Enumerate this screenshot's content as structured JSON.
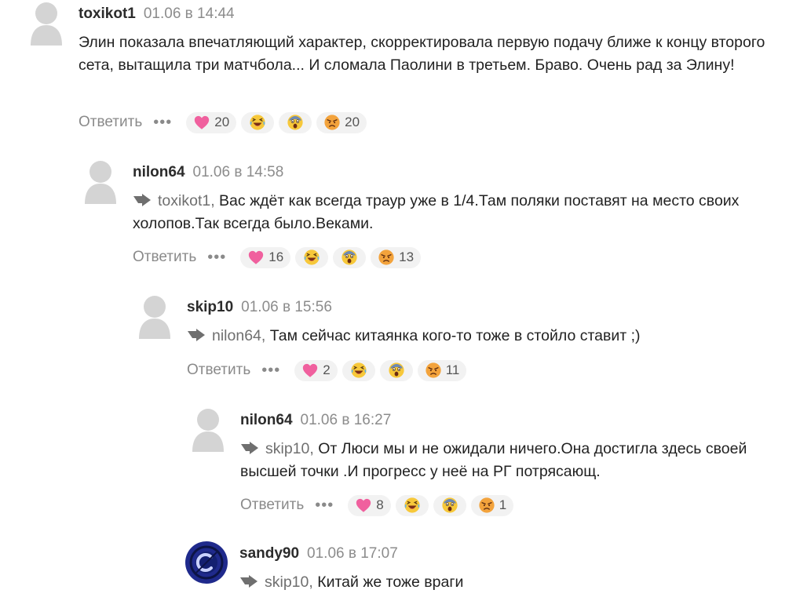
{
  "comments": [
    {
      "author": "toxikot1",
      "date": "01.06 в 14:44",
      "reply_to": "",
      "text": "Элин показала впечатляющий характер, скорректировала первую подачу ближе к концу второго сета, вытащила три матчбола... И сломала Паолини в третьем. Браво. Очень рад за Элину!",
      "reply_label": "Ответить",
      "more_label": "•••",
      "reactions": {
        "love": "20",
        "laugh": "",
        "shock": "",
        "angry": "20"
      }
    },
    {
      "author": "nilon64",
      "date": "01.06 в 14:58",
      "reply_to": "toxikot1,",
      "text": "Вас ждёт как всегда траур уже в 1/4.Там поляки поставят на место своих холопов.Так всегда было.Веками.",
      "reply_label": "Ответить",
      "more_label": "•••",
      "reactions": {
        "love": "16",
        "laugh": "",
        "shock": "",
        "angry": "13"
      }
    },
    {
      "author": "skip10",
      "date": "01.06 в 15:56",
      "reply_to": "nilon64,",
      "text": "Там сейчас китаянка кого-то тоже в стойло ставит ;)",
      "reply_label": "Ответить",
      "more_label": "•••",
      "reactions": {
        "love": "2",
        "laugh": "",
        "shock": "",
        "angry": "11"
      }
    },
    {
      "author": "nilon64",
      "date": "01.06 в 16:27",
      "reply_to": "skip10,",
      "text": "От Люси мы и не ожидали ничего.Она достигла здесь своей высшей точки .И прогресс у неё на РГ потрясающ.",
      "reply_label": "Ответить",
      "more_label": "•••",
      "reactions": {
        "love": "8",
        "laugh": "",
        "shock": "",
        "angry": "1"
      }
    },
    {
      "author": "sandy90",
      "date": "01.06 в 17:07",
      "reply_to": "skip10,",
      "text": "Китай же тоже враги"
    }
  ],
  "colors": {
    "avatar_placeholder": "#d4d4d4",
    "avatar_sandy90_bg": "#1f2a8c",
    "reaction_bg": "#f2f2f2",
    "meta_gray": "#8c8c8c"
  },
  "icons": {
    "reply_arrow": "reply-arrow-icon",
    "more": "more-dots-icon",
    "reactions": [
      "heart-icon",
      "laughing-face-icon",
      "shocked-face-icon",
      "angry-face-icon"
    ]
  }
}
